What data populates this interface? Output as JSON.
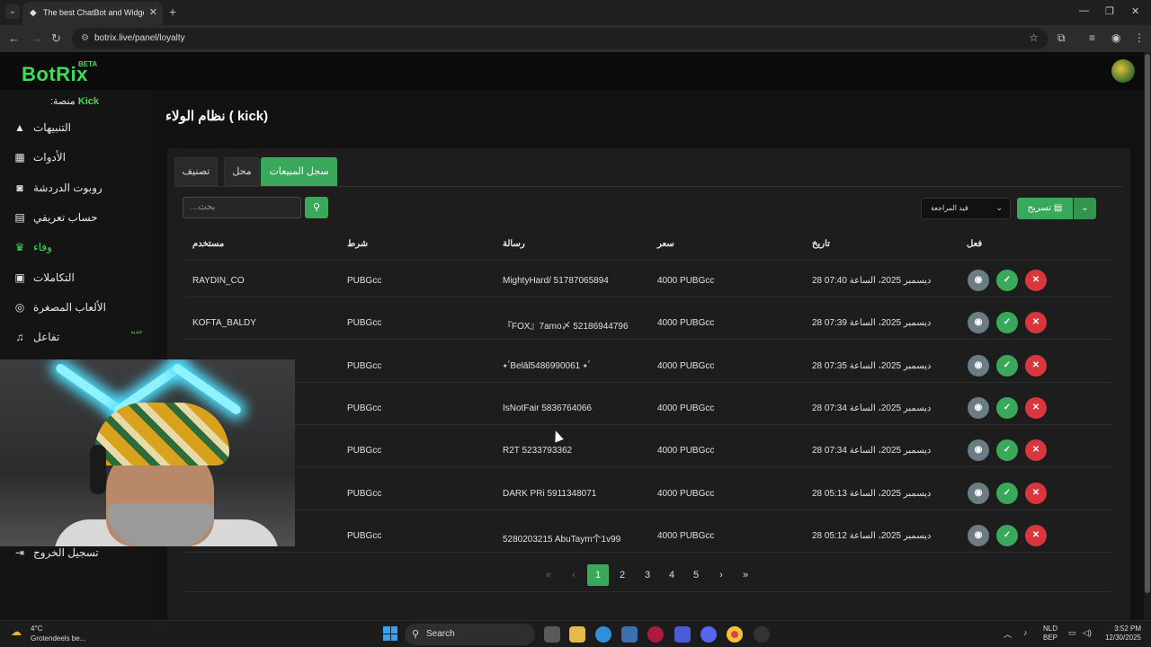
{
  "browser": {
    "tab_title": "The best ChatBot and Widgets",
    "url": "botrix.live/panel/loyalty"
  },
  "app": {
    "logo": "BotRix",
    "beta": "BETA",
    "platform_label": "منصة:",
    "platform_value": "Kick"
  },
  "sidebar": {
    "items": [
      {
        "label": "التنبيهات",
        "icon": "warning-icon"
      },
      {
        "label": "الأدوات",
        "icon": "widgets-icon"
      },
      {
        "label": "روبوت الدردشة",
        "icon": "robot-icon"
      },
      {
        "label": "حساب تعريفي",
        "icon": "id-card-icon"
      },
      {
        "label": "وفاء",
        "icon": "trophy-icon",
        "active": true
      },
      {
        "label": "التكاملات",
        "icon": "integrations-icon"
      },
      {
        "label": "الألعاب المصغرة",
        "icon": "gamepad-icon"
      },
      {
        "label": "تفاعل",
        "icon": "music-icon",
        "badge": "جديد"
      }
    ],
    "logout": "تسجيل الخروج"
  },
  "page": {
    "title": "نظام الولاء ( kick)"
  },
  "tabs": [
    "تصنيف",
    "محل",
    "سجل المبيعات"
  ],
  "toolbar": {
    "search_placeholder": "...بحث",
    "filter_value": "قيد المراجعة",
    "export_label": "تسريح"
  },
  "table": {
    "headers": {
      "user": "مستخدم",
      "condition": "شرط",
      "message": "رسالة",
      "price": "سعر",
      "date": "تاريخ",
      "action": "فعل"
    },
    "rows": [
      {
        "user": "RAYDIN_CO",
        "condition": "PUBGcc",
        "message": "MightyHard/ 51787065894",
        "price": "4000 PUBGcc",
        "date": "28 ديسمبر 2025، الساعة 07:40"
      },
      {
        "user": "KOFTA_BALDY",
        "condition": "PUBGcc",
        "message": "『FOX』7amo〆 52186944796",
        "price": "4000 PUBGcc",
        "date": "28 ديسمبر 2025، الساعة 07:39"
      },
      {
        "user": "",
        "condition": "PUBGcc",
        "message": "ٴ٭Belālٴ٭ 5486990061",
        "price": "4000 PUBGcc",
        "date": "28 ديسمبر 2025، الساعة 07:35"
      },
      {
        "user": "",
        "condition": "PUBGcc",
        "message": "IsNotFair 5836764066",
        "price": "4000 PUBGcc",
        "date": "28 ديسمبر 2025، الساعة 07:34"
      },
      {
        "user": "",
        "condition": "PUBGcc",
        "message": "R2T 5233793362",
        "price": "4000 PUBGcc",
        "date": "28 ديسمبر 2025، الساعة 07:34"
      },
      {
        "user": "",
        "condition": "PUBGcc",
        "message": "DARK PRi 5911348071",
        "price": "4000 PUBGcc",
        "date": "28 ديسمبر 2025، الساعة 05:13"
      },
      {
        "user": "",
        "condition": "PUBGcc",
        "message": "5280203215 AbuTaym个1v99",
        "price": "4000 PUBGcc",
        "date": "28 ديسمبر 2025، الساعة 05:12"
      }
    ]
  },
  "pagination": {
    "first": "«",
    "prev": "‹",
    "pages": [
      "1",
      "2",
      "3",
      "4",
      "5"
    ],
    "active": "1",
    "next": "›",
    "last": "»"
  },
  "taskbar": {
    "temp": "4°C",
    "weather": "Grotendeels be...",
    "search": "Search",
    "lang1": "NLD",
    "lang2": "BEP",
    "time": "3:52 PM",
    "date": "12/30/2025"
  },
  "colors": {
    "accent": "#3aa85a",
    "danger": "#d9363e",
    "view": "#6b7c85",
    "brand": "#3ddc5a"
  }
}
